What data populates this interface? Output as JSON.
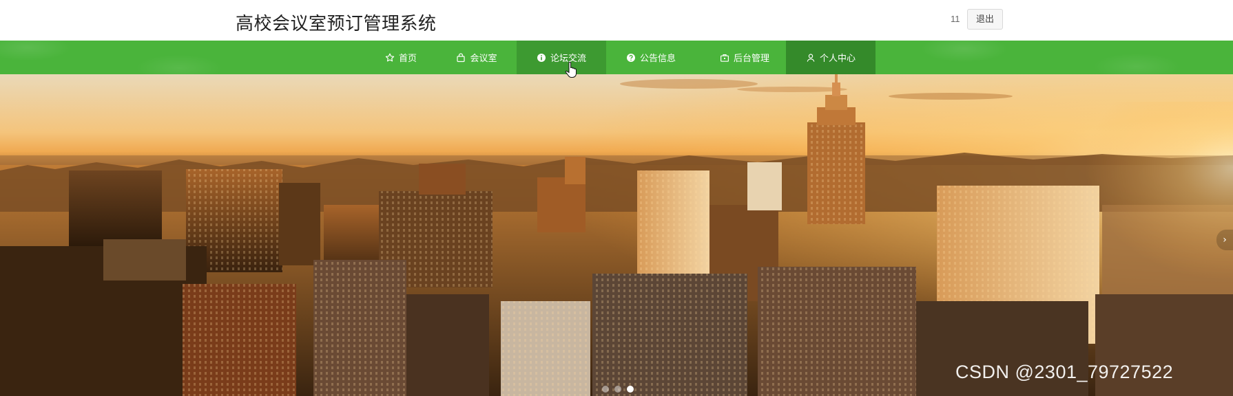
{
  "header": {
    "site_title": "高校会议室预订管理系统",
    "username": "11",
    "logout_label": "退出"
  },
  "nav": {
    "items": [
      {
        "label": "首页",
        "icon": "star-icon"
      },
      {
        "label": "会议室",
        "icon": "bag-icon"
      },
      {
        "label": "论坛交流",
        "icon": "info-circle-icon",
        "state": "hover"
      },
      {
        "label": "公告信息",
        "icon": "question-circle-icon"
      },
      {
        "label": "后台管理",
        "icon": "briefcase-icon"
      },
      {
        "label": "个人中心",
        "icon": "user-icon",
        "state": "active"
      }
    ]
  },
  "banner": {
    "next_arrow": "›",
    "slide_count": 3,
    "active_slide": 3,
    "watermark": "CSDN @2301_79727522"
  },
  "colors": {
    "nav_green": "#4ab43b",
    "nav_hover": "#3d9a31",
    "nav_active": "#348a2a",
    "title_text": "#222222"
  }
}
